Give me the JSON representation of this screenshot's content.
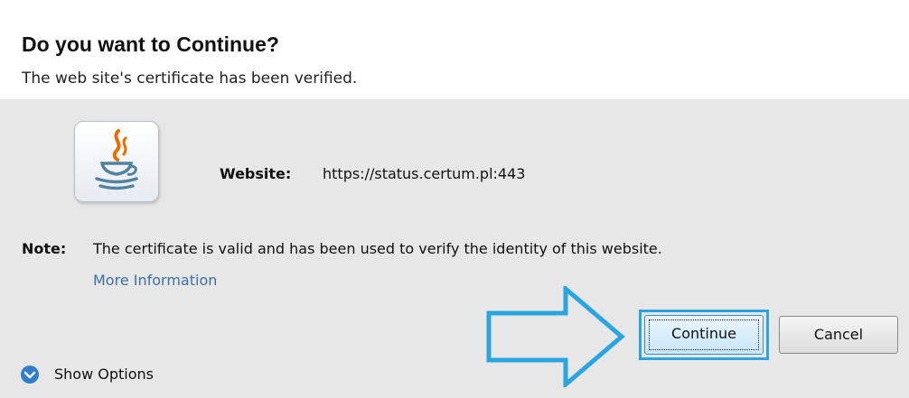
{
  "dialog": {
    "title": "Do you want to Continue?",
    "subtitle": "The web site's certificate has been verified.",
    "website_label": "Website:",
    "website_value": "https://status.certum.pl:443",
    "note_label": "Note:",
    "note_text": "The certificate is valid and has been used to verify the identity of this website.",
    "more_info_link": "More Information",
    "show_options": "Show Options",
    "icon": "java-coffee-cup-icon"
  },
  "buttons": {
    "continue_label": "Continue",
    "cancel_label": "Cancel"
  },
  "colors": {
    "highlight": "#29a6e0",
    "link": "#3f6ea3",
    "panel_bg": "#e7e7e7",
    "header_bg": "#ffffff"
  }
}
